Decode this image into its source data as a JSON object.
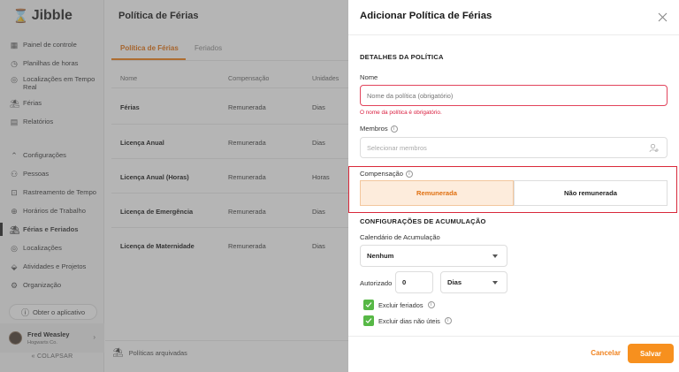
{
  "sidebar": {
    "logo": "Jibble",
    "items": [
      {
        "label": "Painel de controle",
        "icon": "dashboard-icon"
      },
      {
        "label": "Planilhas de horas",
        "icon": "clock-icon"
      },
      {
        "label": "Localizações em Tempo Real",
        "icon": "location-pin-icon"
      },
      {
        "label": "Férias",
        "icon": "beach-icon"
      },
      {
        "label": "Relatórios",
        "icon": "report-icon"
      },
      {
        "label": "Configurações",
        "icon": "chevron-up-icon"
      },
      {
        "label": "Pessoas",
        "icon": "people-icon"
      },
      {
        "label": "Rastreamento de Tempo",
        "icon": "time-tracking-icon"
      },
      {
        "label": "Horários de Trabalho",
        "icon": "work-schedule-icon"
      },
      {
        "label": "Férias e Feriados",
        "icon": "beach-icon"
      },
      {
        "label": "Localizações",
        "icon": "location-pin-icon"
      },
      {
        "label": "Atividades e Projetos",
        "icon": "tag-icon"
      },
      {
        "label": "Organização",
        "icon": "gear-icon"
      }
    ],
    "get_app": "Obter o aplicativo",
    "user": {
      "name": "Fred Weasley",
      "org": "Hogwarts Co."
    },
    "collapse": "COLAPSAR"
  },
  "main": {
    "title": "Política de Férias",
    "tabs": [
      "Política de Férias",
      "Feriados"
    ],
    "columns": [
      "Nome",
      "Compensação",
      "Unidades"
    ],
    "rows": [
      {
        "name": "Férias",
        "comp": "Remunerada",
        "units": "Dias"
      },
      {
        "name": "Licença Anual",
        "comp": "Remunerada",
        "units": "Dias"
      },
      {
        "name": "Licença Anual (Horas)",
        "comp": "Remunerada",
        "units": "Horas"
      },
      {
        "name": "Licença de Emergência",
        "comp": "Remunerada",
        "units": "Dias"
      },
      {
        "name": "Licença de Maternidade",
        "comp": "Remunerada",
        "units": "Dias"
      }
    ],
    "archived": "Políticas arquivadas"
  },
  "panel": {
    "title": "Adicionar Política de Férias",
    "details_title": "DETALHES DA POLÍTICA",
    "name_label": "Nome",
    "name_placeholder": "Nome da política (obrigatório)",
    "name_error": "O nome da política é obrigatório.",
    "members_label": "Membros",
    "members_placeholder": "Selecionar membros",
    "comp_label": "Compensação",
    "comp_options": [
      "Remunerada",
      "Não remunerada"
    ],
    "accrual_title": "CONFIGURAÇÕES DE ACUMULAÇÃO",
    "calendar_label": "Calendário de Acumulação",
    "calendar_value": "Nenhum",
    "authorized_label": "Autorizado",
    "authorized_value": "0",
    "unit_value": "Dias",
    "exclude_holidays": "Excluir feriados",
    "exclude_nonworking": "Excluir dias não úteis",
    "cancel": "Cancelar",
    "save": "Salvar"
  },
  "colors": {
    "accent": "#f7901e",
    "error": "#d81b3c",
    "check": "#57b846"
  }
}
